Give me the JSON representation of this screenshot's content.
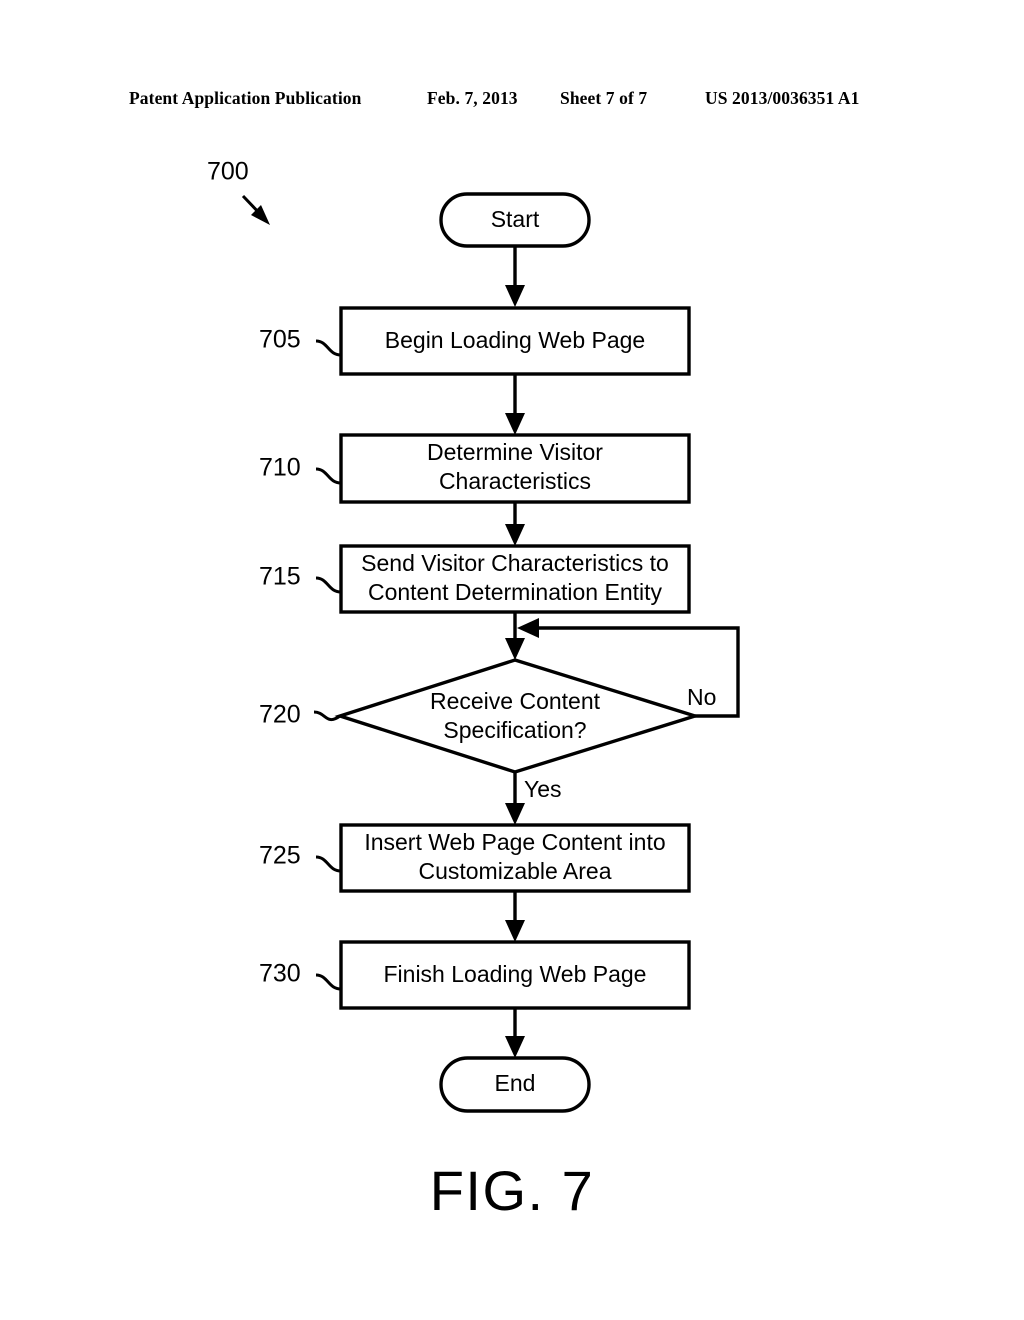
{
  "header": {
    "publication": "Patent Application Publication",
    "date": "Feb. 7, 2013",
    "sheet": "Sheet 7 of 7",
    "publication_number": "US 2013/0036351 A1"
  },
  "figure": {
    "caption": "FIG. 7",
    "diagram_reference": "700",
    "type": "flowchart"
  },
  "nodes": {
    "start": {
      "label": "Start",
      "shape": "terminator"
    },
    "step_705": {
      "ref": "705",
      "label_line1": "Begin Loading Web Page",
      "label_line2": "",
      "shape": "process"
    },
    "step_710": {
      "ref": "710",
      "label_line1": "Determine Visitor",
      "label_line2": "Characteristics",
      "shape": "process"
    },
    "step_715": {
      "ref": "715",
      "label_line1": "Send Visitor Characteristics to",
      "label_line2": "Content Determination Entity",
      "shape": "process"
    },
    "step_720": {
      "ref": "720",
      "label_line1": "Receive Content",
      "label_line2": "Specification?",
      "shape": "decision"
    },
    "step_725": {
      "ref": "725",
      "label_line1": "Insert Web Page Content into",
      "label_line2": "Customizable Area",
      "shape": "process"
    },
    "step_730": {
      "ref": "730",
      "label_line1": "Finish Loading Web Page",
      "label_line2": "",
      "shape": "process"
    },
    "end": {
      "label": "End",
      "shape": "terminator"
    }
  },
  "branches": {
    "yes_label": "Yes",
    "no_label": "No"
  },
  "colors": {
    "ink": "#000000",
    "paper": "#ffffff"
  }
}
